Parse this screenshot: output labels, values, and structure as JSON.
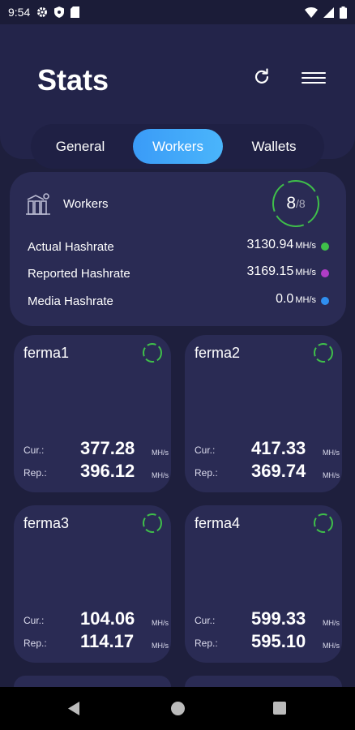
{
  "status_bar": {
    "time": "9:54",
    "left_icons": [
      "gear-icon",
      "shield-icon",
      "sd-card-icon"
    ],
    "right_icons": [
      "wifi-icon",
      "signal-icon",
      "battery-icon"
    ]
  },
  "header": {
    "title": "Stats",
    "refresh_icon": "refresh-icon",
    "menu_icon": "hamburger-menu-icon"
  },
  "tabs": [
    {
      "label": "General",
      "active": false
    },
    {
      "label": "Workers",
      "active": true
    },
    {
      "label": "Wallets",
      "active": false
    }
  ],
  "summary": {
    "label": "Workers",
    "online": "8",
    "total": "/8",
    "rows": [
      {
        "label": "Actual Hashrate",
        "value": "3130.94",
        "unit": "MH/s",
        "color": "#3fbf4a"
      },
      {
        "label": "Reported Hashrate",
        "value": "3169.15",
        "unit": "MH/s",
        "color": "#b03dc6"
      },
      {
        "label": "Media Hashrate",
        "value": "0.0",
        "unit": "MH/s",
        "color": "#2f8ff0"
      }
    ]
  },
  "workers": [
    {
      "name": "ferma1",
      "cur_label": "Cur.:",
      "cur": "377.28",
      "rep_label": "Rep.:",
      "rep": "396.12",
      "unit": "MH/s"
    },
    {
      "name": "ferma2",
      "cur_label": "Cur.:",
      "cur": "417.33",
      "rep_label": "Rep.:",
      "rep": "369.74",
      "unit": "MH/s"
    },
    {
      "name": "ferma3",
      "cur_label": "Cur.:",
      "cur": "104.06",
      "rep_label": "Rep.:",
      "rep": "114.17",
      "unit": "MH/s"
    },
    {
      "name": "ferma4",
      "cur_label": "Cur.:",
      "cur": "599.33",
      "rep_label": "Rep.:",
      "rep": "595.10",
      "unit": "MH/s"
    }
  ],
  "colors": {
    "accent": "#3a9bf7",
    "online_ring": "#3fbf4a"
  }
}
